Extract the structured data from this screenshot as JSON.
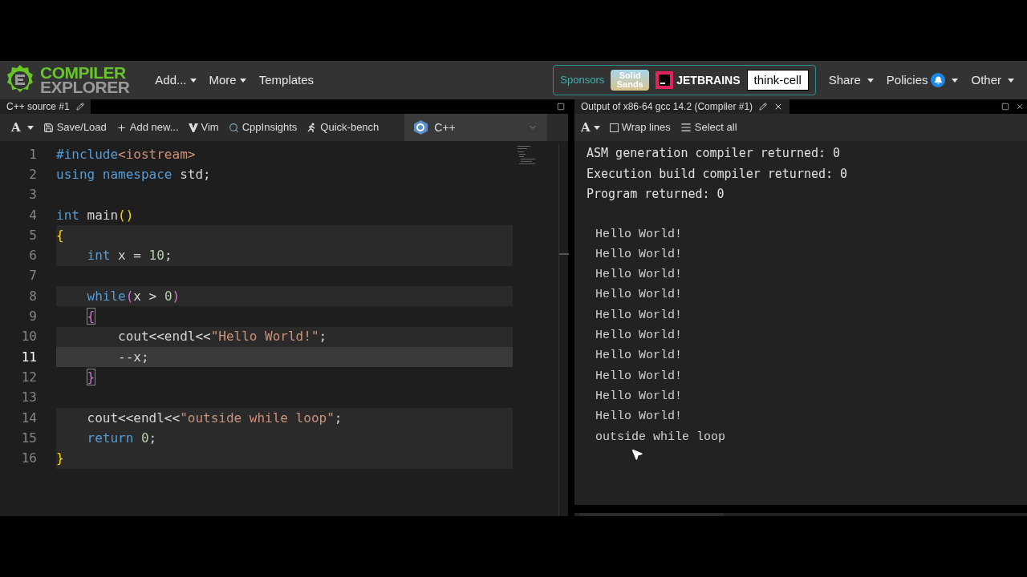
{
  "header": {
    "logo": {
      "line1": "COMPILER",
      "line2": "EXPLORER"
    },
    "menus": [
      {
        "label": "Add...",
        "dropdown": true
      },
      {
        "label": "More",
        "dropdown": true
      },
      {
        "label": "Templates",
        "dropdown": false
      }
    ],
    "sponsors": {
      "label": "Sponsors",
      "solid_sands": [
        "Solid",
        "Sands"
      ],
      "jetbrains": "JETBRAINS",
      "thinkcell": "think-cell"
    },
    "right_menus": [
      {
        "label": "Share",
        "bell": false
      },
      {
        "label": "Policies",
        "bell": true
      },
      {
        "label": "Other",
        "bell": false
      }
    ]
  },
  "editor": {
    "tab": "C++ source #1",
    "toolbar": [
      {
        "kind": "font",
        "label": "A"
      },
      {
        "kind": "save",
        "label": "Save/Load"
      },
      {
        "kind": "add",
        "label": "Add new..."
      },
      {
        "kind": "vim",
        "label": "Vim"
      },
      {
        "kind": "insights",
        "label": "CppInsights"
      },
      {
        "kind": "bench",
        "label": "Quick-bench"
      }
    ],
    "language": "C++",
    "lines": [
      {
        "number": "1",
        "highlighted": false,
        "current": false,
        "tokens": [
          {
            "kind": "keyword",
            "text": "#include"
          },
          {
            "kind": "string",
            "text": "<iostream>"
          }
        ]
      },
      {
        "number": "2",
        "highlighted": false,
        "current": false,
        "tokens": [
          {
            "kind": "keyword",
            "text": "using namespace"
          },
          {
            "kind": "plain",
            "text": " std;"
          }
        ]
      },
      {
        "number": "3"
      },
      {
        "number": "4",
        "highlighted": false,
        "current": false,
        "tokens": [
          {
            "kind": "keyword",
            "text": "int"
          },
          {
            "kind": "plain",
            "text": " main"
          },
          {
            "kind": "paren",
            "text": "()"
          }
        ]
      },
      {
        "number": "5",
        "highlighted": true,
        "current": false,
        "tokens": [
          {
            "kind": "paren",
            "text": "{"
          }
        ]
      },
      {
        "number": "6",
        "highlighted": true,
        "current": false,
        "tokens": [
          {
            "kind": "keyword",
            "text": "    int"
          },
          {
            "kind": "plain",
            "text": " x = "
          },
          {
            "kind": "number",
            "text": "10"
          },
          {
            "kind": "plain",
            "text": ";"
          }
        ]
      },
      {
        "number": "7"
      },
      {
        "number": "8",
        "highlighted": true,
        "current": false,
        "tokens": [
          {
            "kind": "keyword",
            "text": "    while"
          },
          {
            "kind": "paren2",
            "text": "("
          },
          {
            "kind": "plain",
            "text": "x > "
          },
          {
            "kind": "number",
            "text": "0"
          },
          {
            "kind": "paren2",
            "text": ")"
          }
        ]
      },
      {
        "number": "9",
        "highlighted": false,
        "current": false,
        "tokens": [
          {
            "kind": "match",
            "text": "    {"
          }
        ]
      },
      {
        "number": "10",
        "highlighted": true,
        "current": false,
        "tokens": [
          {
            "kind": "plain",
            "text": "        cout<<endl<<"
          },
          {
            "kind": "string",
            "text": "\"Hello World!\""
          },
          {
            "kind": "plain",
            "text": ";"
          }
        ]
      },
      {
        "number": "11",
        "highlighted": true,
        "current": true,
        "tokens": [
          {
            "kind": "plain",
            "text": "        --x;"
          }
        ]
      },
      {
        "number": "12",
        "highlighted": false,
        "current": false,
        "tokens": [
          {
            "kind": "match",
            "text": "    }"
          }
        ]
      },
      {
        "number": "13"
      },
      {
        "number": "14",
        "highlighted": true,
        "current": false,
        "tokens": [
          {
            "kind": "plain",
            "text": "    cout<<endl<<"
          },
          {
            "kind": "string",
            "text": "\"outside while loop\""
          },
          {
            "kind": "plain",
            "text": ";"
          }
        ]
      },
      {
        "number": "15",
        "highlighted": true,
        "current": false,
        "tokens": [
          {
            "kind": "keyword",
            "text": "    return"
          },
          {
            "kind": "number",
            "text": " 0"
          },
          {
            "kind": "plain",
            "text": ";"
          }
        ]
      },
      {
        "number": "16",
        "highlighted": true,
        "current": false,
        "tokens": [
          {
            "kind": "paren",
            "text": "}"
          }
        ]
      }
    ]
  },
  "output": {
    "tab": "Output of x86-64 gcc 14.2 (Compiler #1)",
    "font_label": "A",
    "wrap_lines": {
      "label": "Wrap lines",
      "checked": false
    },
    "select_all": "Select all",
    "status": [
      "ASM generation compiler returned: 0",
      "Execution build compiler returned: 0",
      "Program returned: 0"
    ],
    "program_output": [
      "Hello World!",
      "Hello World!",
      "Hello World!",
      "Hello World!",
      "Hello World!",
      "Hello World!",
      "Hello World!",
      "Hello World!",
      "Hello World!",
      "Hello World!",
      "outside while loop"
    ]
  }
}
